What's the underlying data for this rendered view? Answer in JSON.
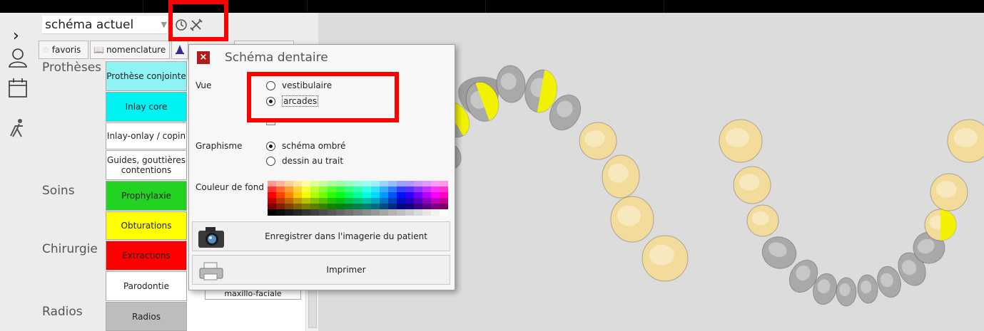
{
  "toolbar": {
    "scheme_value": "schéma actuel"
  },
  "tabs": [
    {
      "label": "favoris",
      "icon": "star-icon"
    },
    {
      "label": "nomenclature",
      "icon": "book-icon"
    }
  ],
  "categories": [
    "Prothèses",
    "Soins",
    "Chirurgie",
    "Radios"
  ],
  "actions": [
    {
      "label": "Prothèse conjointe",
      "color": "#8ff3f3"
    },
    {
      "label": "Inlay core",
      "color": "#00f2f2"
    },
    {
      "label": "Inlay-onlay / copin",
      "color": "#ffffff"
    },
    {
      "label": "Guides, gouttières contentions",
      "color": "#ffffff"
    },
    {
      "label": "Prophylaxie",
      "color": "#22d322"
    },
    {
      "label": "Obturations",
      "color": "#ffff00"
    },
    {
      "label": "Extractions",
      "color": "#ff0000"
    },
    {
      "label": "Parodontie",
      "color": "#ffffff"
    },
    {
      "label": "Radios",
      "color": "#bdbdbd"
    }
  ],
  "actions_right": [
    {
      "label": "maxillo-faciale"
    }
  ],
  "dialog": {
    "title": "Schéma dentaire",
    "close": "×",
    "vue_label": "Vue",
    "vue_options": [
      "vestibulaire",
      "arcades"
    ],
    "vue_selected": "arcades",
    "graphisme_label": "Graphisme",
    "graphisme_options": [
      "schéma ombré",
      "dessin au trait"
    ],
    "graphisme_selected": "schéma ombré",
    "bg_label": "Couleur de fond",
    "save_label": "Enregistrer dans l'imagerie du patient",
    "print_label": "Imprimer"
  },
  "colors": {
    "highlight": "#ff0000",
    "tooth_fill": "#f3dc9b",
    "tooth_grey": "#a9a9a9",
    "tooth_yellow": "#f2f200"
  }
}
